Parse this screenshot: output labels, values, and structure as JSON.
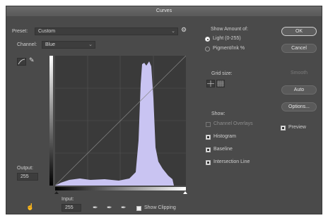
{
  "dialog": {
    "title": "Curves"
  },
  "preset": {
    "label": "Preset:",
    "value": "Custom"
  },
  "channel": {
    "label": "Channel:",
    "value": "Blue"
  },
  "curve": {
    "output_label": "Output:",
    "output_value": "255",
    "input_label": "Input:",
    "input_value": "255"
  },
  "show_amount": {
    "title": "Show Amount of:",
    "light_label": "Light (0-255)",
    "pigment_label": "Pigment/Ink %",
    "light_selected": true
  },
  "grid_size": {
    "title": "Grid size:"
  },
  "show": {
    "title": "Show:",
    "channel_overlays": {
      "label": "Channel Overlays",
      "checked": false,
      "enabled": false
    },
    "histogram": {
      "label": "Histogram",
      "checked": true
    },
    "baseline": {
      "label": "Baseline",
      "checked": true
    },
    "intersection_line": {
      "label": "Intersection Line",
      "checked": true
    }
  },
  "buttons": {
    "ok": "OK",
    "cancel": "Cancel",
    "smooth": "Smooth",
    "auto": "Auto",
    "options": "Options..."
  },
  "preview": {
    "label": "Preview",
    "checked": true
  },
  "show_clipping": {
    "label": "Show Clipping",
    "checked": false
  },
  "histogram_color": "#c9c4f2"
}
